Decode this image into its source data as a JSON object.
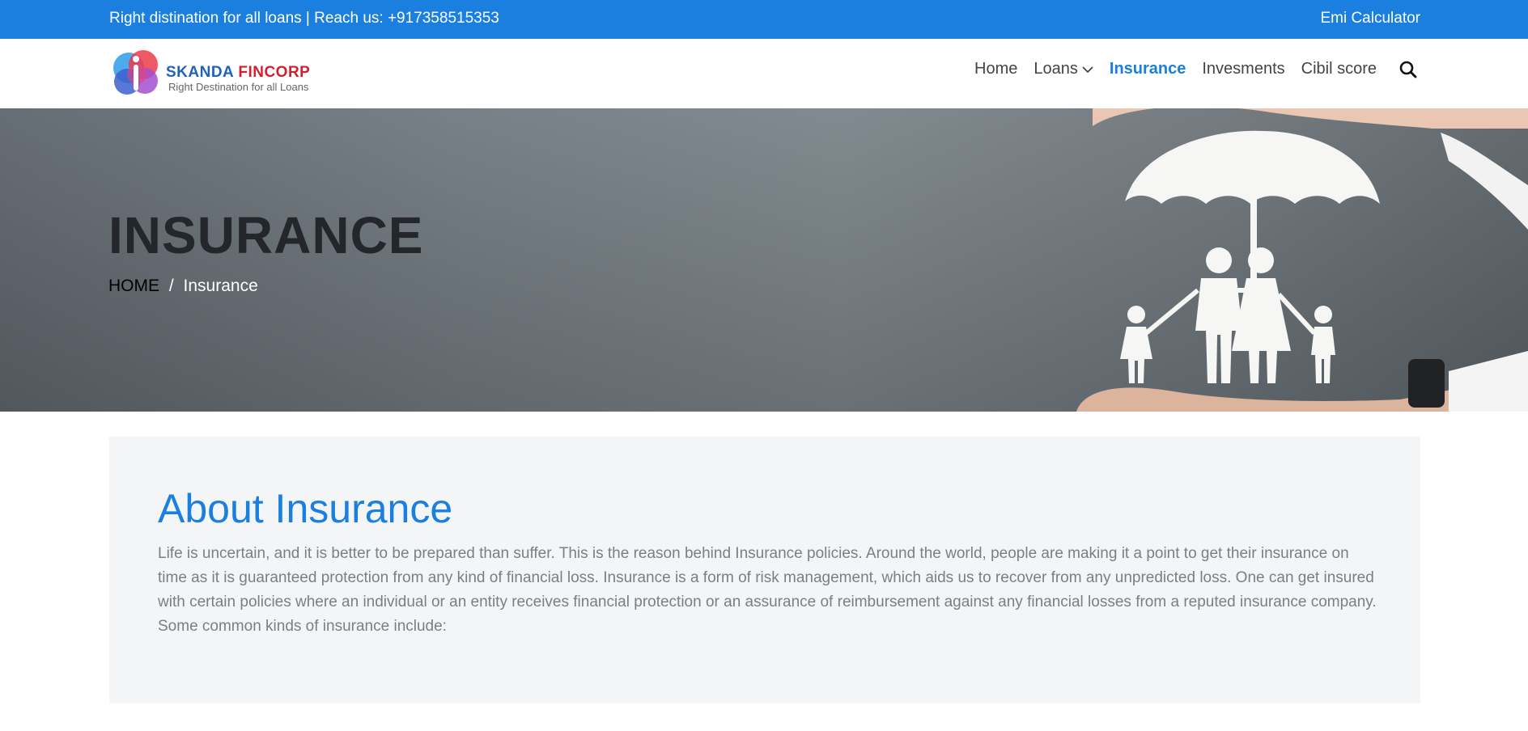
{
  "topbar": {
    "tagline": "Right distination for all loans | Reach us: +917358515353",
    "emi_link": "Emi Calculator"
  },
  "logo": {
    "brand_part1": "SKANDA",
    "brand_part2": "FINCORP",
    "slogan": "Right Destination for all Loans"
  },
  "nav": {
    "items": [
      {
        "label": "Home"
      },
      {
        "label": "Loans"
      },
      {
        "label": "Insurance"
      },
      {
        "label": "Invesments"
      },
      {
        "label": "Cibil score"
      }
    ],
    "active": "Insurance",
    "search_icon": "search-icon"
  },
  "hero": {
    "title": "INSURANCE",
    "breadcrumb_home": "HOME",
    "breadcrumb_sep": "/",
    "breadcrumb_current": "Insurance"
  },
  "about": {
    "heading": "About Insurance",
    "body": "Life is uncertain, and it is better to be prepared than suffer. This is the reason behind Insurance policies. Around the world, people are making it a point to get their insurance on time as it is guaranteed protection from any kind of financial loss. Insurance is a form of risk management, which aids us to recover from any unpredicted loss. One can get insured with certain policies where an individual or an entity receives financial protection or an assurance of reimbursement against any financial losses from a reputed insurance company. Some common kinds of insurance include:"
  },
  "colors": {
    "accent": "#1b7fe0",
    "brand_blue": "#1e63b8",
    "brand_red": "#d21f2f",
    "hero_title": "#23272b",
    "about_bg": "#f4f5f7",
    "body_text": "#7a7f85"
  }
}
